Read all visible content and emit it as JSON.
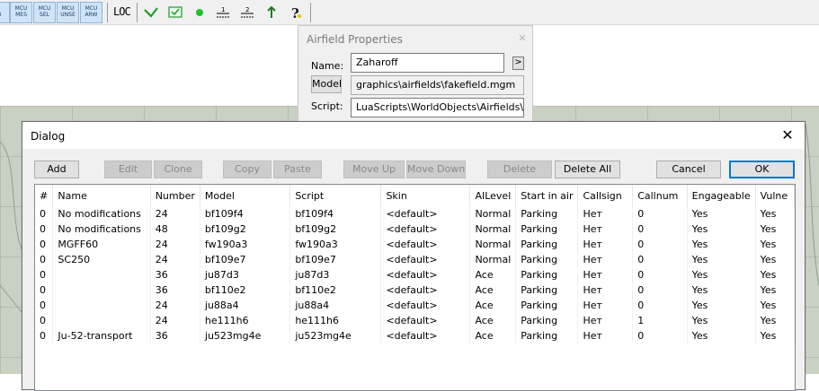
{
  "toolbar": {
    "mcu_buttons": [
      {
        "label": "\n R",
        "icon": "mcu-partial-icon"
      },
      {
        "label": "MCU\nMES",
        "icon": "mcu-mes-icon"
      },
      {
        "label": "MCU\nSEL",
        "icon": "mcu-sel-icon"
      },
      {
        "label": "MCU\nUNSE",
        "icon": "mcu-unse-icon"
      },
      {
        "label": "MCU\nARW",
        "icon": "mcu-arw-icon"
      }
    ],
    "loc_label": "LOC",
    "icons": [
      "check-icon",
      "envelope-check-icon",
      "green-dot-icon",
      "one-over-line-icon",
      "two-over-line-icon",
      "arrow-up-green-icon",
      "help-question-icon"
    ]
  },
  "airfield_properties": {
    "title": "Airfield Properties",
    "name_label": "Name:",
    "name_value": "Zaharoff",
    "arrow_label": ">",
    "model_button": "Model",
    "model_value": "graphics\\airfields\\fakefield.mgm",
    "script_label": "Script:",
    "script_value": "LuaScripts\\WorldObjects\\Airfields\\fake"
  },
  "dialog": {
    "title": "Dialog",
    "buttons": {
      "add": "Add",
      "edit": "Edit",
      "clone": "Clone",
      "copy": "Copy",
      "paste": "Paste",
      "move_up": "Move Up",
      "move_down": "Move Down",
      "delete": "Delete",
      "delete_all": "Delete All",
      "cancel": "Cancel",
      "ok": "OK"
    },
    "columns": [
      "#",
      "Name",
      "Number",
      "Model",
      "Script",
      "Skin",
      "AILevel",
      "Start in air",
      "Callsign",
      "Callnum",
      "Engageable",
      "Vulne"
    ],
    "rows": [
      [
        "0",
        "No modifications",
        "24",
        "bf109f4",
        "bf109f4",
        "<default>",
        "Normal",
        "Parking",
        "Нет",
        "0",
        "Yes",
        "Yes"
      ],
      [
        "0",
        "No modifications",
        "48",
        "bf109g2",
        "bf109g2",
        "<default>",
        "Normal",
        "Parking",
        "Нет",
        "0",
        "Yes",
        "Yes"
      ],
      [
        "0",
        "MGFF60",
        "24",
        "fw190a3",
        "fw190a3",
        "<default>",
        "Normal",
        "Parking",
        "Нет",
        "0",
        "Yes",
        "Yes"
      ],
      [
        "0",
        "SC250",
        "24",
        "bf109e7",
        "bf109e7",
        "<default>",
        "Normal",
        "Parking",
        "Нет",
        "0",
        "Yes",
        "Yes"
      ],
      [
        "0",
        "",
        "36",
        "ju87d3",
        "ju87d3",
        "<default>",
        "Ace",
        "Parking",
        "Нет",
        "0",
        "Yes",
        "Yes"
      ],
      [
        "0",
        "",
        "36",
        "bf110e2",
        "bf110e2",
        "<default>",
        "Ace",
        "Parking",
        "Нет",
        "0",
        "Yes",
        "Yes"
      ],
      [
        "0",
        "",
        "24",
        "ju88a4",
        "ju88a4",
        "<default>",
        "Ace",
        "Parking",
        "Нет",
        "0",
        "Yes",
        "Yes"
      ],
      [
        "0",
        "",
        "24",
        "he111h6",
        "he111h6",
        "<default>",
        "Ace",
        "Parking",
        "Нет",
        "1",
        "Yes",
        "Yes"
      ],
      [
        "0",
        "Ju-52-transport",
        "36",
        "ju523mg4e",
        "ju523mg4e",
        "<default>",
        "Ace",
        "Parking",
        "Нет",
        "0",
        "Yes",
        "Yes"
      ]
    ]
  }
}
